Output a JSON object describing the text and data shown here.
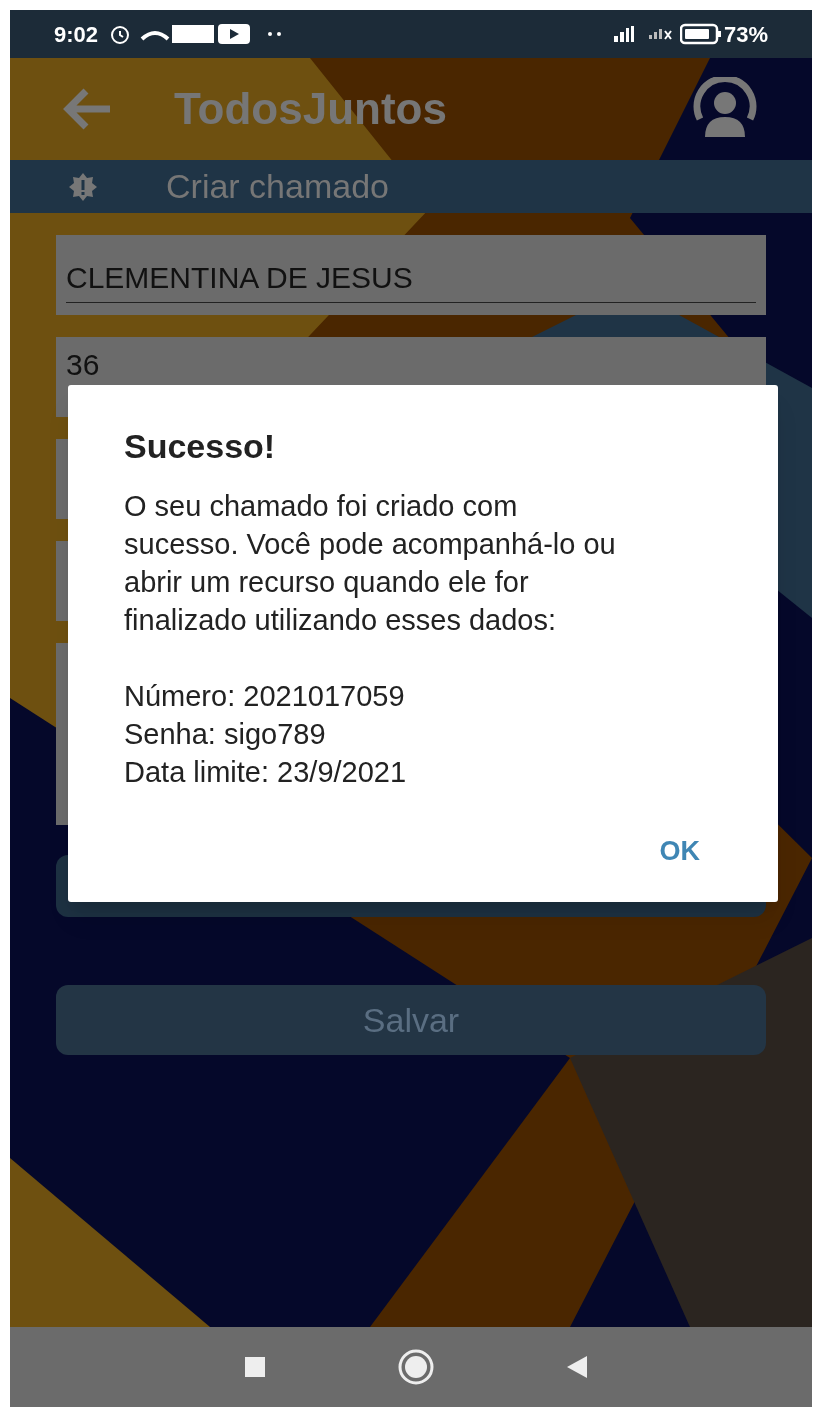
{
  "status_bar": {
    "time": "9:02",
    "battery": "73%"
  },
  "app_bar": {
    "title": "TodosJuntos"
  },
  "section": {
    "title": "Criar chamado"
  },
  "form": {
    "fields": [
      {
        "kind": "text",
        "value": "CLEMENTINA DE JESUS"
      },
      {
        "kind": "text",
        "value": "36"
      },
      {
        "kind": "text"
      },
      {
        "kind": "text"
      },
      {
        "kind": "multiline"
      },
      {
        "kind": "button"
      }
    ],
    "save_button": "Salvar"
  },
  "dialog": {
    "title": "Sucesso!",
    "message": "O seu chamado foi criado com sucesso. Você pode acompanhá-lo ou abrir um recurso quando ele for finalizado utilizando esses dados:",
    "details": [
      "Número: 2021017059",
      "Senha: sigo789",
      "Data limite: 23/9/2021"
    ],
    "button": "OK"
  }
}
